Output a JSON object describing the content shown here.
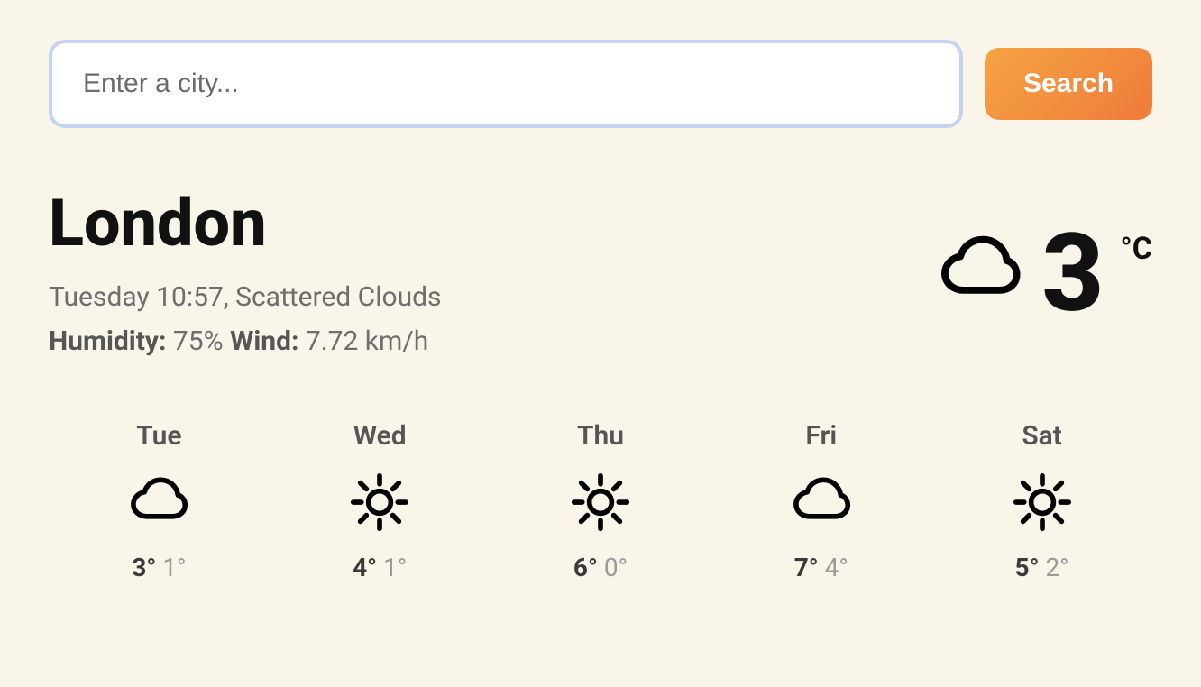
{
  "search": {
    "placeholder": "Enter a city...",
    "button_label": "Search"
  },
  "current": {
    "city": "London",
    "datetime_condition": "Tuesday 10:57, Scattered Clouds",
    "humidity_label": "Humidity:",
    "humidity_value": "75%",
    "wind_label": "Wind:",
    "wind_value": "7.72 km/h",
    "temp": "3",
    "unit": "°C",
    "icon": "cloud"
  },
  "forecast": [
    {
      "day": "Tue",
      "icon": "cloud",
      "hi": "3°",
      "lo": "1°"
    },
    {
      "day": "Wed",
      "icon": "sun",
      "hi": "4°",
      "lo": "1°"
    },
    {
      "day": "Thu",
      "icon": "sun",
      "hi": "6°",
      "lo": "0°"
    },
    {
      "day": "Fri",
      "icon": "cloud",
      "hi": "7°",
      "lo": "4°"
    },
    {
      "day": "Sat",
      "icon": "sun",
      "hi": "5°",
      "lo": "2°"
    }
  ]
}
